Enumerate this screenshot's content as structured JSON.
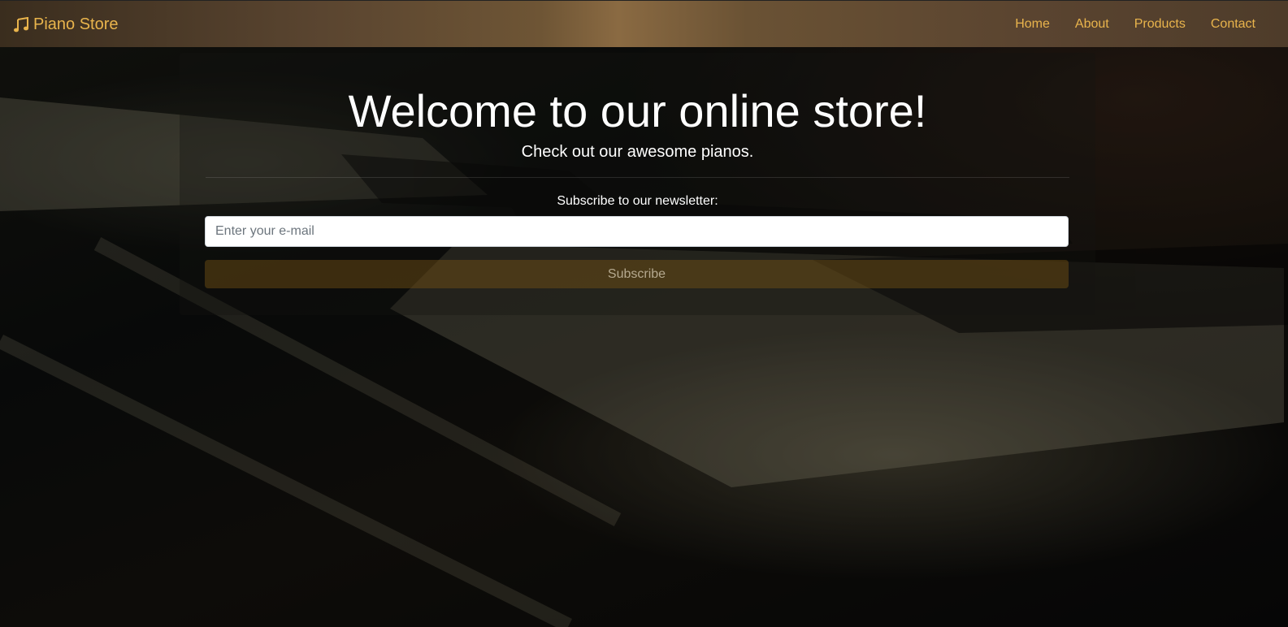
{
  "navbar": {
    "brand": "Piano Store",
    "brand_icon": "music-note-icon",
    "links": [
      "Home",
      "About",
      "Products",
      "Contact"
    ]
  },
  "hero": {
    "title": "Welcome to our online store!",
    "subtitle": "Check out our awesome pianos.",
    "newsletter_label": "Subscribe to our newsletter:",
    "email_placeholder": "Enter your e-mail",
    "email_value": "",
    "subscribe_label": "Subscribe"
  },
  "colors": {
    "accent": "#e9b44c",
    "navbar": "#6e5535",
    "button": "#785514"
  }
}
